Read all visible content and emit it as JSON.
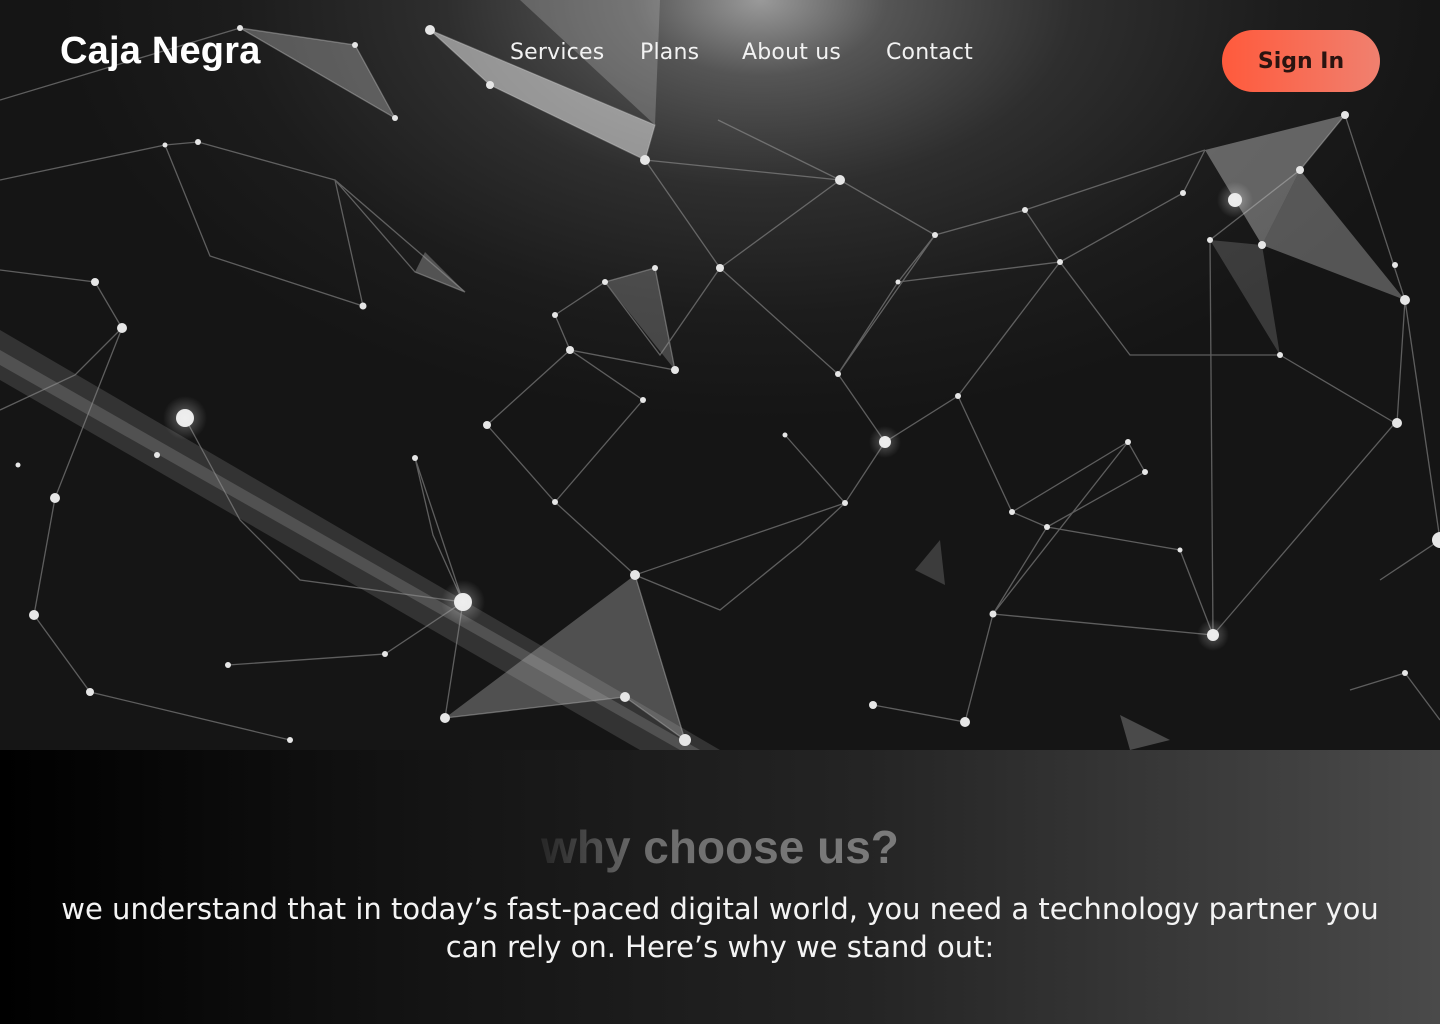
{
  "header": {
    "logo": "Caja Negra",
    "nav": [
      {
        "label": "Services"
      },
      {
        "label": "Plans"
      },
      {
        "label": "About us"
      },
      {
        "label": "Contact"
      }
    ],
    "signin_label": "Sign In"
  },
  "colors": {
    "accent_gradient_start": "#ff5a3c",
    "accent_gradient_end": "#f0806f",
    "hero_background": "#1c1c1c",
    "text": "#ffffff"
  },
  "why": {
    "title": "why choose us?",
    "text": "we understand that in today’s fast-paced digital world, you need a technology partner you can rely on. Here’s why we stand out:"
  }
}
